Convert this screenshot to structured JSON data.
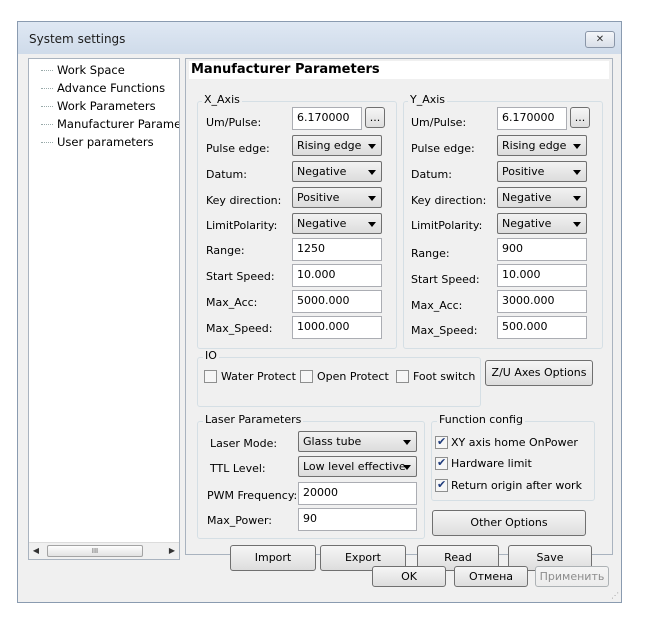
{
  "window": {
    "title": "System settings",
    "close_glyph": "✕"
  },
  "tree": {
    "items": [
      "Work Space",
      "Advance Functions",
      "Work Parameters",
      "Manufacturer Paramet",
      "User parameters"
    ],
    "scroll_thumb": "III"
  },
  "panel": {
    "title": "Manufacturer Parameters"
  },
  "x_axis": {
    "label": "X_Axis",
    "um_pulse_label": "Um/Pulse:",
    "um_pulse": "6.170000",
    "browse": "...",
    "pulse_edge_label": "Pulse edge:",
    "pulse_edge": "Rising edge",
    "datum_label": "Datum:",
    "datum": "Negative",
    "key_dir_label": "Key direction:",
    "key_dir": "Positive",
    "limit_label": "LimitPolarity:",
    "limit": "Negative",
    "range_label": "Range:",
    "range": "1250",
    "start_speed_label": "Start Speed:",
    "start_speed": "10.000",
    "max_acc_label": "Max_Acc:",
    "max_acc": "5000.000",
    "max_speed_label": "Max_Speed:",
    "max_speed": "1000.000"
  },
  "y_axis": {
    "label": "Y_Axis",
    "um_pulse_label": "Um/Pulse:",
    "um_pulse": "6.170000",
    "browse": "...",
    "pulse_edge_label": "Pulse edge:",
    "pulse_edge": "Rising edge",
    "datum_label": "Datum:",
    "datum": "Positive",
    "key_dir_label": "Key direction:",
    "key_dir": "Negative",
    "limit_label": "LimitPolarity:",
    "limit": "Negative",
    "range_label": "Range:",
    "range": "900",
    "start_speed_label": "Start Speed:",
    "start_speed": "10.000",
    "max_acc_label": "Max_Acc:",
    "max_acc": "3000.000",
    "max_speed_label": "Max_Speed:",
    "max_speed": "500.000"
  },
  "io": {
    "label": "IO",
    "water_protect": "Water Protect",
    "water_checked": false,
    "open_protect": "Open Protect",
    "open_checked": false,
    "foot_switch": "Foot switch",
    "foot_checked": false,
    "zu_button": "Z/U Axes Options"
  },
  "laser": {
    "label": "Laser Parameters",
    "mode_label": "Laser Mode:",
    "mode": "Glass tube",
    "ttl_label": "TTL Level:",
    "ttl": "Low level effective",
    "pwm_label": "PWM Frequency:",
    "pwm": "20000",
    "max_power_label": "Max_Power:",
    "max_power": "90"
  },
  "function_config": {
    "label": "Function config",
    "xy_home": "XY axis home OnPower",
    "xy_home_checked": true,
    "hw_limit": "Hardware limit",
    "hw_limit_checked": true,
    "return_origin": "Return origin after work",
    "return_origin_checked": true,
    "other_options": "Other Options"
  },
  "actions": {
    "import": "Import",
    "export": "Export",
    "read": "Read",
    "save": "Save"
  },
  "footer": {
    "ok": "OK",
    "cancel": "Отмена",
    "apply": "Применить"
  }
}
